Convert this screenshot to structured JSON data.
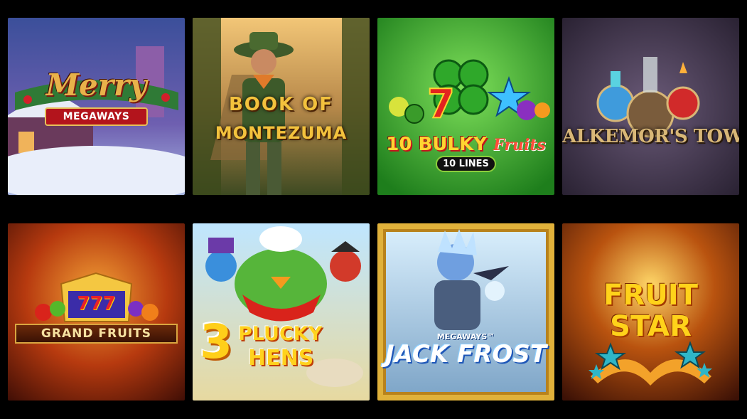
{
  "games": [
    {
      "title": "Merry",
      "subtitle": "MEGAWAYS"
    },
    {
      "line1": "BOOK OF",
      "line2": "MONTEZUMA"
    },
    {
      "title_number": "10 BULKY",
      "title_word": "Fruits",
      "subtitle": "10 LINES"
    },
    {
      "title": "ALKEMOR'S TOWER"
    },
    {
      "title": "GRAND FRUITS",
      "emblem": "777"
    },
    {
      "number": "3",
      "line1": "PLUCKY",
      "line2": "HENS"
    },
    {
      "subtitle": "MEGAWAYS™",
      "title": "JACK FROST"
    },
    {
      "line1": "FRUIT",
      "line2": "STAR"
    }
  ],
  "colors": {
    "background": "#000000",
    "accent_gold": "#f3c23d",
    "green": "#2fa82a"
  }
}
